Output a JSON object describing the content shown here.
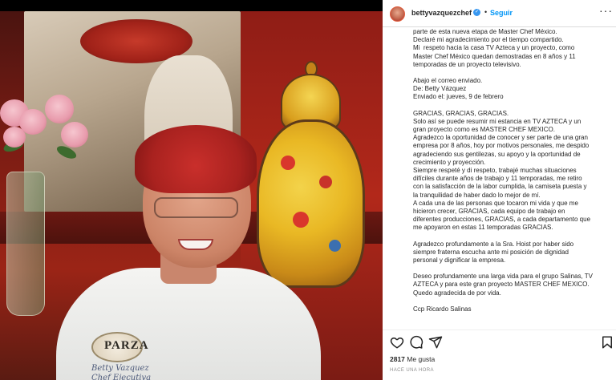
{
  "post": {
    "username": "bettyvazquezchef",
    "verified_badge": "✓",
    "separator": "•",
    "follow_label": "Seguir",
    "more_label": "···",
    "photo": {
      "patch_text": "PARZA",
      "embroidery_line1": "Betty Vazquez",
      "embroidery_line2": "Chef Ejecutiva"
    },
    "caption_lines": [
      "parte de esta nueva etapa de Master Chef México.",
      "Declaré mi agradecimiento por el tiempo compartido.",
      "Mi  respeto hacia la casa TV Azteca y un proyecto, como",
      "Master Chef México quedan demostradas en 8 años y 11",
      "temporadas de un proyecto televisivo.",
      "",
      "Abajo el correo enviado.",
      "De: Betty Vázquez",
      "Enviado el: jueves, 9 de febrero",
      "",
      "GRACIAS, GRACIAS, GRACIAS.",
      "Solo así se puede resumir mi estancia en TV AZTECA y un",
      "gran proyecto como es MASTER CHEF MEXICO.",
      "Agradezco la oportunidad de conocer y ser parte de una gran",
      "empresa por 8 años, hoy por motivos personales, me despido",
      "agradeciendo sus gentilezas, su apoyo y la oportunidad de",
      "crecimiento y proyección.",
      "Siempre respeté y di respeto, trabajé muchas situaciones",
      "difíciles durante años de trabajo y 11 temporadas, me retiro",
      "con la satisfacción de la labor cumplida, la camiseta puesta y",
      "la tranquilidad de haber dado lo mejor de mí.",
      "A cada una de las personas que tocaron mi vida y que me",
      "hicieron crecer, GRACIAS, cada equipo de trabajo en",
      "diferentes producciones, GRACIAS, a cada departamento que",
      "me apoyaron en estas 11 temporadas GRACIAS.",
      "",
      "Agradezco profundamente a la Sra. Hoist por haber sido",
      "siempre fraterna escucha ante mi posición de dignidad",
      "personal y dignificar la empresa.",
      "",
      "Deseo profundamente una larga vida para el grupo Salinas, TV",
      "AZTECA y para este gran proyecto MASTER CHEF MEXICO.",
      "Quedo agradecida de por vida.",
      "",
      "Ccp Ricardo Salinas"
    ],
    "actions": {
      "like_icon": "heart-icon",
      "comment_icon": "comment-icon",
      "share_icon": "share-icon",
      "save_icon": "bookmark-icon"
    },
    "likes_count": "2817",
    "likes_label": "Me gusta",
    "timestamp": "HACE UNA HORA"
  },
  "colors": {
    "link": "#0095f6",
    "verified": "#3897f0",
    "text": "#262626",
    "muted": "#8e8e8e"
  }
}
